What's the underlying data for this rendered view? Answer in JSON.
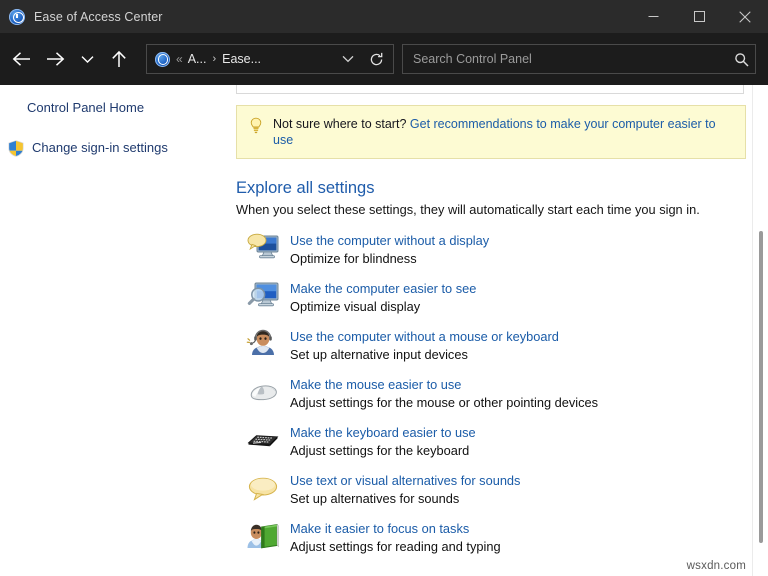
{
  "window": {
    "title": "Ease of Access Center",
    "icon": "ease-of-access-icon",
    "controls": {
      "minimize": "minimize-button",
      "maximize": "maximize-button",
      "close": "close-button"
    }
  },
  "nav": {
    "back": "back-button",
    "forward": "forward-button",
    "recent": "recent-locations-button",
    "up": "up-button",
    "address": {
      "icon": "ease-of-access-icon",
      "overflow": "«",
      "crumb1": "A...",
      "separator": "›",
      "crumb2": "Ease...",
      "dropdown": "address-dropdown-icon",
      "refresh": "refresh-icon"
    },
    "search": {
      "placeholder": "Search Control Panel",
      "value": "",
      "icon": "search-icon"
    }
  },
  "sidebar": {
    "items": [
      {
        "label": "Control Panel Home",
        "icon": ""
      },
      {
        "label": "Change sign-in settings",
        "icon": "shield-icon"
      }
    ]
  },
  "tip": {
    "icon": "lightbulb-icon",
    "prompt": "Not sure where to start?",
    "link": "Get recommendations to make your computer easier to use"
  },
  "main": {
    "heading": "Explore all settings",
    "subheading": "When you select these settings, they will automatically start each time you sign in.",
    "settings": [
      {
        "icon": "monitor-speech-icon",
        "link": "Use the computer without a display",
        "desc": "Optimize for blindness"
      },
      {
        "icon": "monitor-magnifier-icon",
        "link": "Make the computer easier to see",
        "desc": "Optimize visual display"
      },
      {
        "icon": "person-headset-icon",
        "link": "Use the computer without a mouse or keyboard",
        "desc": "Set up alternative input devices"
      },
      {
        "icon": "mouse-icon",
        "link": "Make the mouse easier to use",
        "desc": "Adjust settings for the mouse or other pointing devices"
      },
      {
        "icon": "keyboard-icon",
        "link": "Make the keyboard easier to use",
        "desc": "Adjust settings for the keyboard"
      },
      {
        "icon": "speech-bubble-icon",
        "link": "Use text or visual alternatives for sounds",
        "desc": "Set up alternatives for sounds"
      },
      {
        "icon": "person-book-icon",
        "link": "Make it easier to focus on tasks",
        "desc": "Adjust settings for reading and typing"
      }
    ]
  },
  "watermark": "wsxdn.com",
  "colors": {
    "titlebar": "#2b2b2b",
    "navbar": "#1c1c1c",
    "link": "#1b5ca8",
    "heading": "#1f5cab",
    "tip_bg": "#fdfbd3",
    "tip_border": "#e6e0a8"
  }
}
